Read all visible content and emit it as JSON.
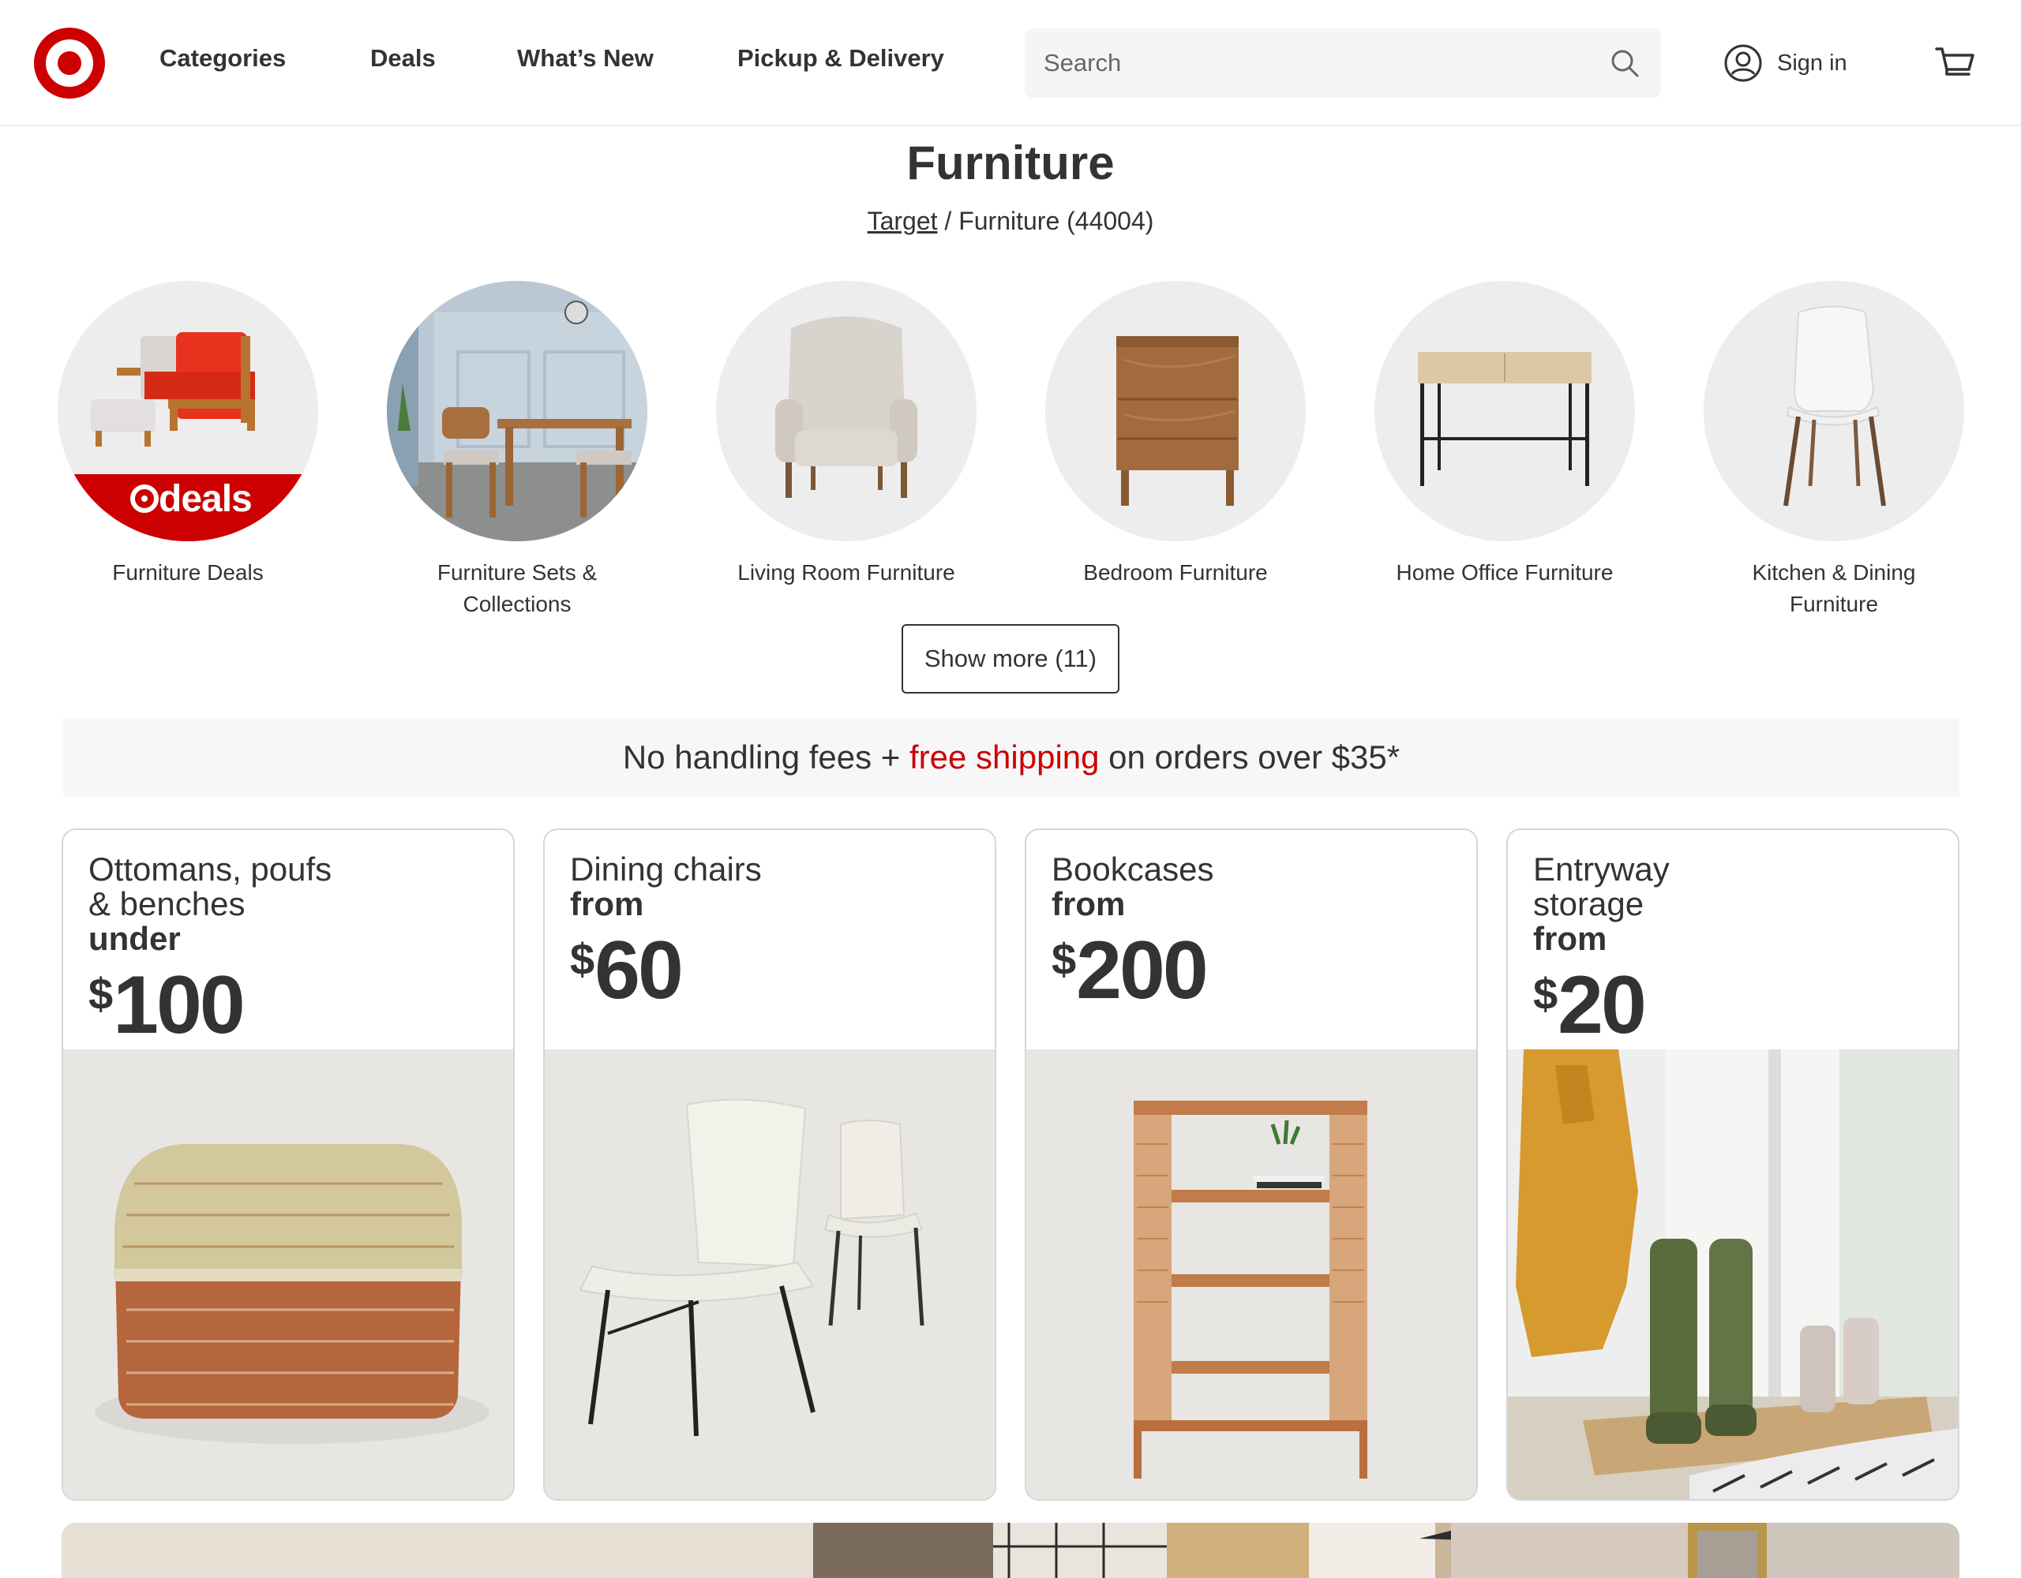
{
  "header": {
    "nav": [
      "Categories",
      "Deals",
      "What’s New",
      "Pickup & Delivery"
    ],
    "search_placeholder": "Search",
    "sign_in_label": "Sign in",
    "brand_color": "#cc0000"
  },
  "page": {
    "title": "Furniture",
    "breadcrumb_link": "Target",
    "breadcrumb_separator": "/",
    "breadcrumb_current": "Furniture (44004)"
  },
  "categories": [
    {
      "label": "Furniture Deals",
      "badge": "deals"
    },
    {
      "label": "Furniture Sets & Collections"
    },
    {
      "label": "Living Room Furniture"
    },
    {
      "label": "Bedroom Furniture"
    },
    {
      "label": "Home Office Furniture"
    },
    {
      "label": "Kitchen & Dining Furniture"
    }
  ],
  "show_more_label": "Show more (11)",
  "promo": {
    "before": "No handling fees + ",
    "highlight": "free shipping",
    "after": " on orders over $35*"
  },
  "deal_cards": [
    {
      "title_line1": "Ottomans, poufs",
      "title_line2": "& benches",
      "qualifier": "under",
      "currency": "$",
      "amount": "100"
    },
    {
      "title_line1": "Dining chairs",
      "title_line2": "",
      "qualifier": "from",
      "currency": "$",
      "amount": "60"
    },
    {
      "title_line1": "Bookcases",
      "title_line2": "",
      "qualifier": "from",
      "currency": "$",
      "amount": "200"
    },
    {
      "title_line1": "Entryway",
      "title_line2": "storage",
      "qualifier": "from",
      "currency": "$",
      "amount": "20"
    }
  ]
}
